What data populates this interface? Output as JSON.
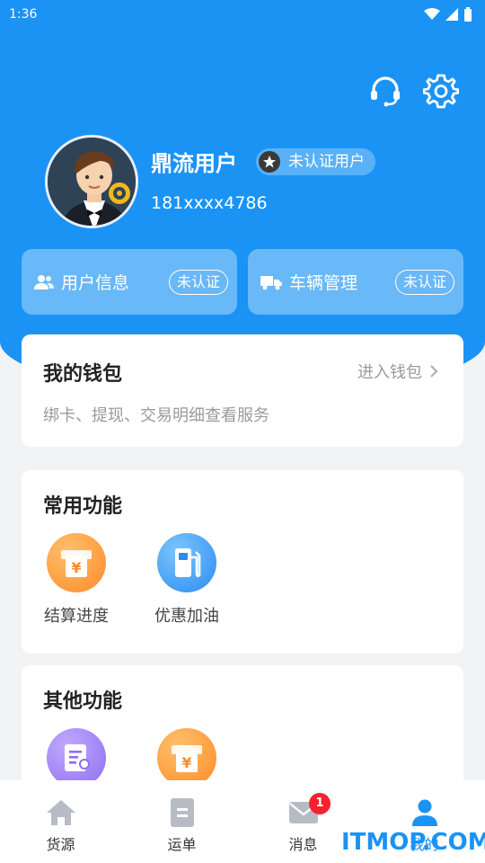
{
  "status_bar": {
    "time": "1:36"
  },
  "profile": {
    "name": "鼎流用户",
    "badge": "未认证用户",
    "phone": "181xxxx4786"
  },
  "quick_cards": [
    {
      "label": "用户信息",
      "status": "未认证",
      "icon": "users-icon"
    },
    {
      "label": "车辆管理",
      "status": "未认证",
      "icon": "truck-icon"
    }
  ],
  "wallet": {
    "title": "我的钱包",
    "enter_label": "进入钱包",
    "description": "绑卡、提现、交易明细查看服务"
  },
  "common_functions": {
    "title": "常用功能",
    "items": [
      {
        "label": "结算进度",
        "icon": "settlement-icon"
      },
      {
        "label": "优惠加油",
        "icon": "fuel-pump-icon"
      }
    ]
  },
  "other_functions": {
    "title": "其他功能",
    "items": [
      {
        "icon": "document-icon"
      },
      {
        "icon": "settlement-icon"
      }
    ]
  },
  "tabs": [
    {
      "label": "货源",
      "icon": "home-icon"
    },
    {
      "label": "运单",
      "icon": "waybill-icon"
    },
    {
      "label": "消息",
      "icon": "mail-icon",
      "badge": "1"
    },
    {
      "label": "我的",
      "icon": "user-icon",
      "active": true
    }
  ],
  "watermark": "ITMOP.COM",
  "colors": {
    "primary": "#1a93f5",
    "badge_red": "#f5222d",
    "orange": "#ff9a3c",
    "purple": "#9b7bf0"
  }
}
